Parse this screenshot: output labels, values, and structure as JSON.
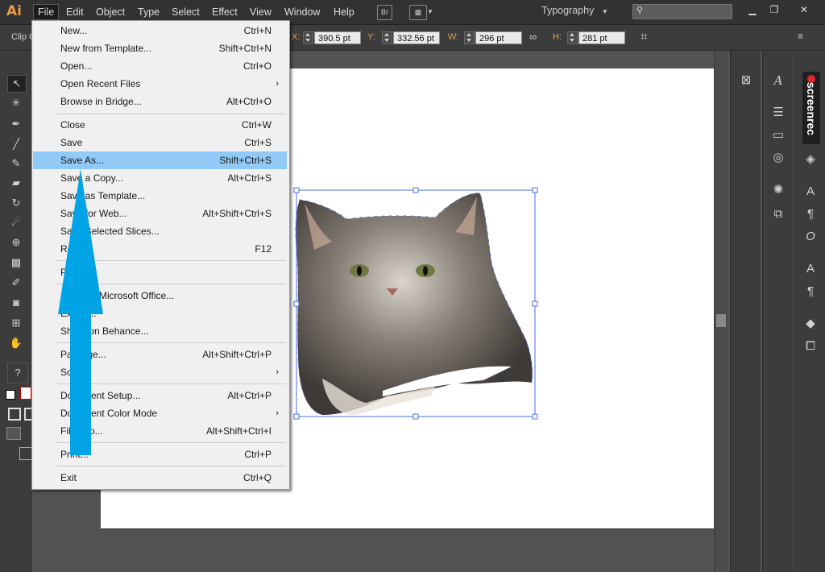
{
  "app": {
    "logo": "Ai",
    "menus": [
      "File",
      "Edit",
      "Object",
      "Type",
      "Select",
      "Effect",
      "View",
      "Window",
      "Help"
    ],
    "bridge_icon": "Br",
    "workspace": "Typography",
    "search_placeholder": ""
  },
  "controlbar": {
    "clip_label": "Clip G",
    "x_label": "X:",
    "x_value": "390.5 pt",
    "y_label": "Y:",
    "y_value": "332.56 pt",
    "w_label": "W:",
    "w_value": "296 pt",
    "h_label": "H:",
    "h_value": "281 pt"
  },
  "file_menu": {
    "items": [
      {
        "label": "New...",
        "shortcut": "Ctrl+N"
      },
      {
        "label": "New from Template...",
        "shortcut": "Shift+Ctrl+N"
      },
      {
        "label": "Open...",
        "shortcut": "Ctrl+O"
      },
      {
        "label": "Open Recent Files",
        "shortcut": "",
        "submenu": true
      },
      {
        "label": "Browse in Bridge...",
        "shortcut": "Alt+Ctrl+O"
      },
      {
        "label": "Close",
        "shortcut": "Ctrl+W"
      },
      {
        "label": "Save",
        "shortcut": "Ctrl+S"
      },
      {
        "label": "Save As...",
        "shortcut": "Shift+Ctrl+S",
        "highlighted": true
      },
      {
        "label": "Save a Copy...",
        "shortcut": "Alt+Ctrl+S"
      },
      {
        "label": "Save as Template...",
        "shortcut": ""
      },
      {
        "label": "Save for Web...",
        "shortcut": "Alt+Shift+Ctrl+S"
      },
      {
        "label": "Save Selected Slices...",
        "shortcut": ""
      },
      {
        "label": "Revert",
        "shortcut": "F12"
      },
      {
        "label": "Place...",
        "shortcut": ""
      },
      {
        "label": "Save for Microsoft Office...",
        "shortcut": ""
      },
      {
        "label": "Export...",
        "shortcut": ""
      },
      {
        "label": "Share on Behance...",
        "shortcut": ""
      },
      {
        "label": "Package...",
        "shortcut": "Alt+Shift+Ctrl+P"
      },
      {
        "label": "Scripts",
        "shortcut": "",
        "submenu": true
      },
      {
        "label": "Document Setup...",
        "shortcut": "Alt+Ctrl+P"
      },
      {
        "label": "Document Color Mode",
        "shortcut": "",
        "submenu": true
      },
      {
        "label": "File Info...",
        "shortcut": "Alt+Shift+Ctrl+I"
      },
      {
        "label": "Print...",
        "shortcut": "Ctrl+P"
      },
      {
        "label": "Exit",
        "shortcut": "Ctrl+Q"
      }
    ]
  },
  "right_panel": {
    "screenrec_label": "screenrec"
  },
  "colors": {
    "highlight": "#91c9f7",
    "arrow": "#00a3e6",
    "ai_logo": "#e49b4c",
    "selection": "#4a6fe0"
  }
}
